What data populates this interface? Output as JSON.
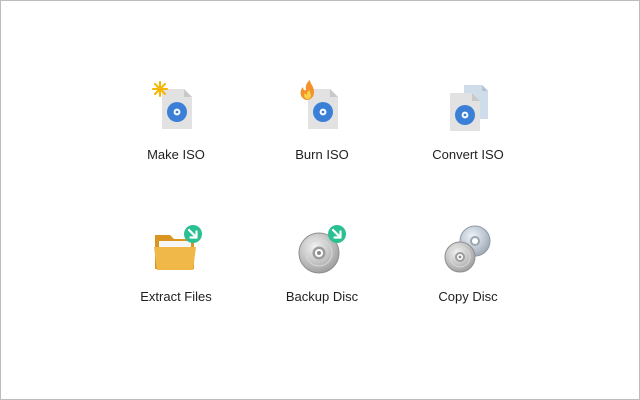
{
  "tools": [
    {
      "label": "Make ISO",
      "icon": "make-iso-icon"
    },
    {
      "label": "Burn ISO",
      "icon": "burn-iso-icon"
    },
    {
      "label": "Convert ISO",
      "icon": "convert-iso-icon"
    },
    {
      "label": "Extract Files",
      "icon": "extract-files-icon"
    },
    {
      "label": "Backup Disc",
      "icon": "backup-disc-icon"
    },
    {
      "label": "Copy Disc",
      "icon": "copy-disc-icon"
    }
  ],
  "colors": {
    "disc_blue": "#3b80d6",
    "doc_gray": "#dcdcdc",
    "folder_orange": "#f0b848",
    "badge_teal": "#2dbf94",
    "flame_orange": "#f3922a",
    "spark_yellow": "#f7b400",
    "label_text": "#1f1f1f"
  }
}
